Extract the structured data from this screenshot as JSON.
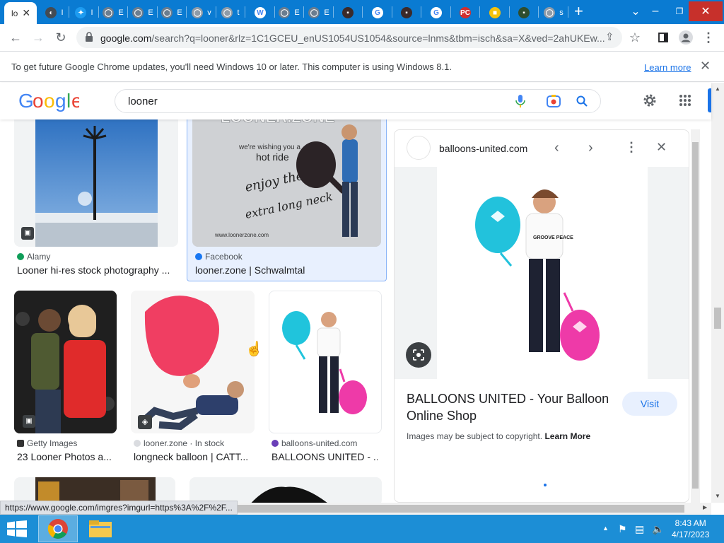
{
  "browser": {
    "active_tab_label": "lo",
    "tab_favicons": [
      {
        "name": "wikimedia",
        "color": "#444b53",
        "glyph": "◐"
      },
      {
        "name": "twitter",
        "color": "#1d9bf0",
        "glyph": "✦"
      },
      {
        "name": "generic",
        "color": "#6b7d8f",
        "glyph": "◯"
      },
      {
        "name": "generic",
        "color": "#6b7d8f",
        "glyph": "◯"
      },
      {
        "name": "generic",
        "color": "#6b7d8f",
        "glyph": "◯"
      },
      {
        "name": "generic",
        "color": "#8e9ba8",
        "glyph": "◯"
      },
      {
        "name": "generic",
        "color": "#8e9ba8",
        "glyph": "◯"
      },
      {
        "name": "wikipedia",
        "color": "#ffffff",
        "glyph": "W"
      },
      {
        "name": "generic",
        "color": "#6b7d8f",
        "glyph": "◯"
      },
      {
        "name": "generic",
        "color": "#6b7d8f",
        "glyph": "◯"
      },
      {
        "name": "photo",
        "color": "#3b2a2a",
        "glyph": "▪"
      },
      {
        "name": "google",
        "color": "#ffffff",
        "glyph": "G"
      },
      {
        "name": "photo",
        "color": "#3b2a2a",
        "glyph": "▪"
      },
      {
        "name": "google",
        "color": "#ffffff",
        "glyph": "G"
      },
      {
        "name": "pcmag",
        "color": "#d32f2f",
        "glyph": "PC"
      },
      {
        "name": "folder",
        "color": "#f4c20d",
        "glyph": "■"
      },
      {
        "name": "photo",
        "color": "#2e4d2e",
        "glyph": "▪"
      },
      {
        "name": "generic",
        "color": "#8e9ba8",
        "glyph": "◯"
      }
    ],
    "tab_snippets": [
      "I",
      "I",
      "E",
      "E",
      "E",
      "v",
      "t",
      "",
      "E",
      "E",
      "",
      "",
      "",
      "",
      "",
      "",
      "",
      "s"
    ],
    "url_main": "google.com",
    "url_rest": "/search?q=looner&rlz=1C1GCEU_enUS1054US1054&source=lnms&tbm=isch&sa=X&ved=2ahUKEw..."
  },
  "infobar": {
    "message": "To get future Google Chrome updates, you'll need Windows 10 or later. This computer is using Windows 8.1.",
    "link": "Learn more"
  },
  "google": {
    "query": "looner"
  },
  "results": [
    {
      "source": "Alamy",
      "title": "Looner hi-res stock photography ...",
      "source_color": "#0f9d58"
    },
    {
      "source": "Facebook",
      "title": "looner.zone | Schwalmtal",
      "source_color": "#1877f2"
    },
    {
      "source": "Getty Images",
      "title": "23 Looner Photos a...",
      "source_color": "#333333"
    },
    {
      "source": "looner.zone · In stock",
      "title": "longneck balloon | CATT...",
      "source_color": "#9aa0a6"
    },
    {
      "source": "balloons-united.com",
      "title": "BALLOONS UNITED - ...",
      "source_color": "#6a3fb8"
    }
  ],
  "facebook_card": {
    "brand": "LOONER.ZONE",
    "lines": [
      "we're wishing you a",
      "hot ride",
      "enjoy the",
      "extra long neck"
    ],
    "url": "www.loonerzone.com"
  },
  "preview": {
    "domain": "balloons-united.com",
    "title": "BALLOONS UNITED - Your Balloon Online Shop",
    "copyright": "Images may be subject to copyright.",
    "learn_more": "Learn More",
    "visit": "Visit",
    "shirt_text": "GROOVE PEACE"
  },
  "status_url": "https://www.google.com/imgres?imgurl=https%3A%2F%2F...",
  "taskbar": {
    "time": "8:43 AM",
    "date": "4/17/2023"
  }
}
